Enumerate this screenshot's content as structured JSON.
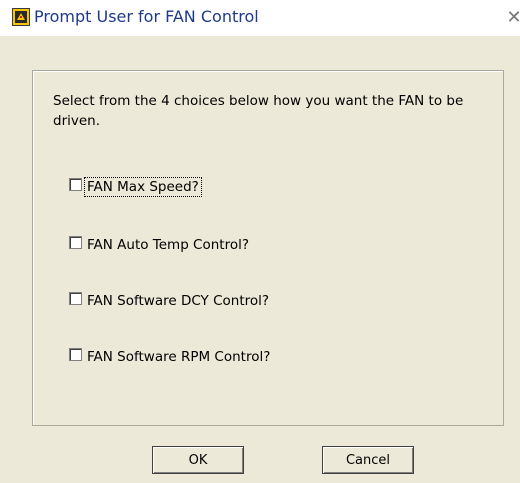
{
  "window": {
    "title": "Prompt User for FAN Control",
    "close_glyph": "✕"
  },
  "dialog": {
    "instructions": "Select from the 4 choices below how you want the FAN to be driven.",
    "choices": [
      {
        "label": "FAN Max Speed?",
        "checked": false
      },
      {
        "label": "FAN Auto Temp Control?",
        "checked": false
      },
      {
        "label": "FAN Software DCY Control?",
        "checked": false
      },
      {
        "label": "FAN Software RPM Control?",
        "checked": false
      }
    ]
  },
  "buttons": {
    "ok": "OK",
    "cancel": "Cancel"
  },
  "colors": {
    "title_text": "#1f3a8a",
    "dialog_bg": "#ece9d8"
  }
}
